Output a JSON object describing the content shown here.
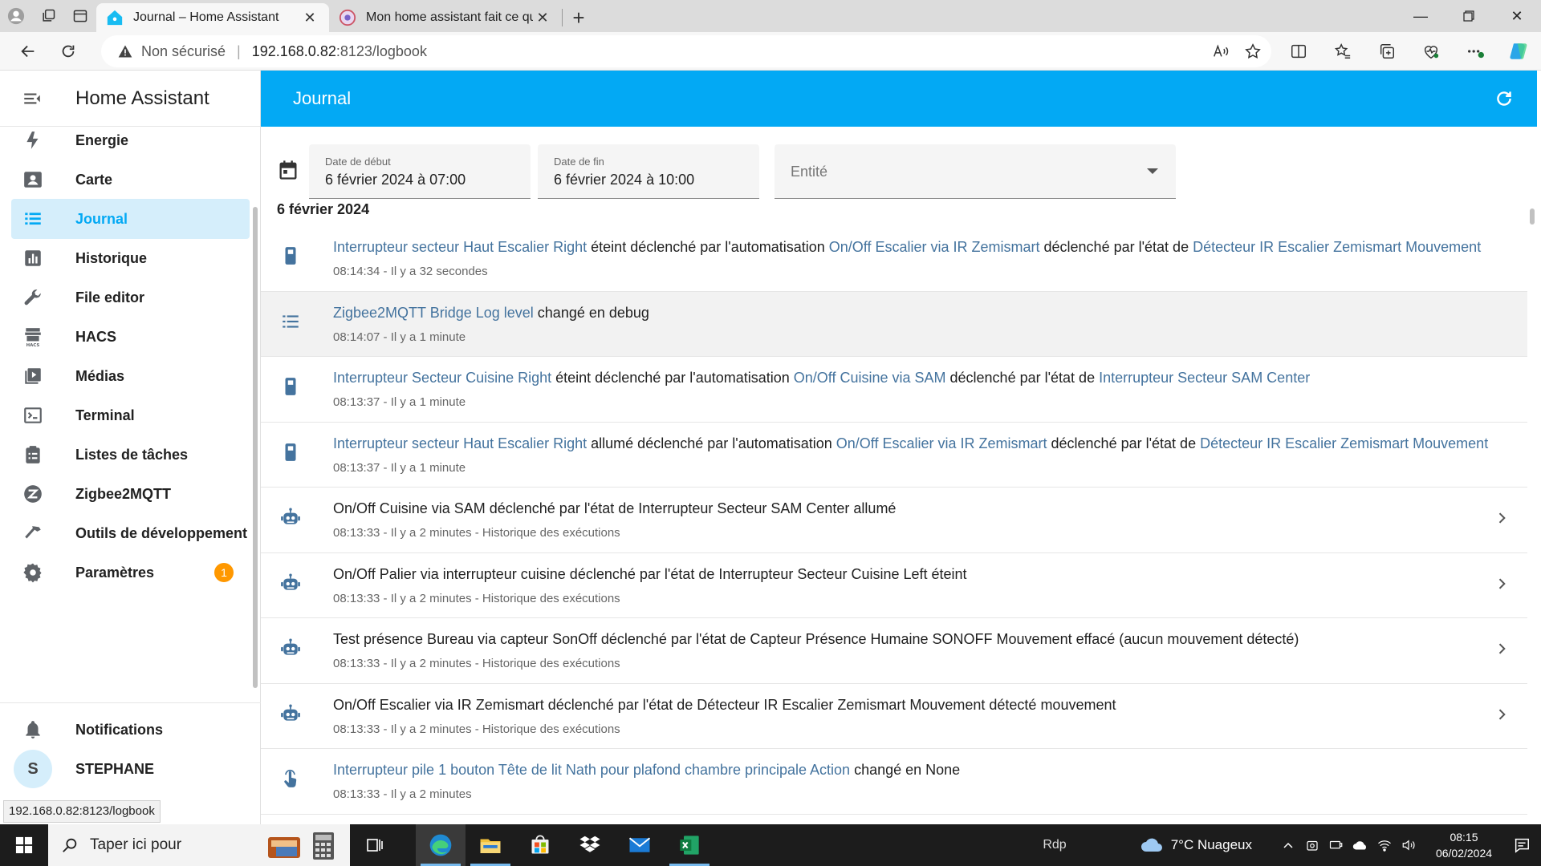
{
  "browser": {
    "tabs": [
      {
        "title": "Journal – Home Assistant",
        "active": true
      },
      {
        "title": "Mon home assistant fait ce qu'il veut",
        "active": false
      }
    ],
    "address": {
      "security": "Non sécurisé",
      "host": "192.168.0.82",
      "path": ":8123/logbook"
    },
    "status_url": "192.168.0.82:8123/logbook"
  },
  "sidebar": {
    "app_title": "Home Assistant",
    "items": [
      {
        "label": "Energie",
        "icon": "lightning-icon"
      },
      {
        "label": "Carte",
        "icon": "map-icon"
      },
      {
        "label": "Journal",
        "icon": "list-icon",
        "active": true
      },
      {
        "label": "Historique",
        "icon": "chart-icon"
      },
      {
        "label": "File editor",
        "icon": "wrench-icon"
      },
      {
        "label": "HACS",
        "icon": "hacs-icon"
      },
      {
        "label": "Médias",
        "icon": "media-icon"
      },
      {
        "label": "Terminal",
        "icon": "terminal-icon"
      },
      {
        "label": "Listes de tâches",
        "icon": "clipboard-icon"
      },
      {
        "label": "Zigbee2MQTT",
        "icon": "zigbee-icon"
      },
      {
        "label": "Outils de développement",
        "icon": "hammer-icon"
      },
      {
        "label": "Paramètres",
        "icon": "gear-icon",
        "badge": "1"
      }
    ],
    "notifications_label": "Notifications",
    "user": {
      "initial": "S",
      "name": "STEPHANE"
    }
  },
  "header": {
    "title": "Journal"
  },
  "filters": {
    "start": {
      "label": "Date de début",
      "value": "6 février 2024 à 07:00"
    },
    "end": {
      "label": "Date de fin",
      "value": "6 février 2024 à 10:00"
    },
    "entity": {
      "placeholder": "Entité"
    }
  },
  "log": {
    "date_heading": "6 février 2024",
    "entries": [
      {
        "icon": "switch-icon",
        "parts": [
          {
            "t": "Interrupteur secteur Haut Escalier Right",
            "link": true
          },
          {
            "t": " éteint déclenché par l'automatisation "
          },
          {
            "t": "On/Off Escalier via IR Zemismart",
            "link": true
          },
          {
            "t": " déclenché par l'état de "
          },
          {
            "t": "Détecteur IR Escalier Zemismart Mouvement",
            "link": true
          }
        ],
        "meta": "08:14:34 - Il y a 32 secondes"
      },
      {
        "icon": "list-icon",
        "highlight": true,
        "parts": [
          {
            "t": "Zigbee2MQTT Bridge Log level",
            "link": true
          },
          {
            "t": " changé en debug"
          }
        ],
        "meta": "08:14:07 - Il y a 1 minute"
      },
      {
        "icon": "switch-icon",
        "parts": [
          {
            "t": "Interrupteur Secteur Cuisine Right",
            "link": true
          },
          {
            "t": " éteint déclenché par l'automatisation "
          },
          {
            "t": "On/Off Cuisine via SAM",
            "link": true
          },
          {
            "t": " déclenché par l'état de "
          },
          {
            "t": "Interrupteur Secteur SAM Center",
            "link": true
          }
        ],
        "meta": "08:13:37 - Il y a 1 minute"
      },
      {
        "icon": "switch-icon",
        "parts": [
          {
            "t": "Interrupteur secteur Haut Escalier Right",
            "link": true
          },
          {
            "t": " allumé déclenché par l'automatisation "
          },
          {
            "t": "On/Off Escalier via IR Zemismart",
            "link": true
          },
          {
            "t": " déclenché par l'état de "
          },
          {
            "t": "Détecteur IR Escalier Zemismart Mouvement",
            "link": true
          }
        ],
        "meta": "08:13:37 - Il y a 1 minute"
      },
      {
        "icon": "robot-icon",
        "chevron": true,
        "parts": [
          {
            "t": "On/Off Cuisine via SAM déclenché par l'état de Interrupteur Secteur SAM Center allumé"
          }
        ],
        "meta": "08:13:33 - Il y a 2 minutes - Historique des exécutions"
      },
      {
        "icon": "robot-icon",
        "chevron": true,
        "parts": [
          {
            "t": "On/Off Palier via interrupteur cuisine déclenché par l'état de Interrupteur Secteur Cuisine Left éteint"
          }
        ],
        "meta": "08:13:33 - Il y a 2 minutes - Historique des exécutions"
      },
      {
        "icon": "robot-icon",
        "chevron": true,
        "parts": [
          {
            "t": "Test présence Bureau via capteur SonOff déclenché par l'état de Capteur Présence Humaine SONOFF Mouvement effacé (aucun mouvement détecté)"
          }
        ],
        "meta": "08:13:33 - Il y a 2 minutes - Historique des exécutions"
      },
      {
        "icon": "robot-icon",
        "chevron": true,
        "parts": [
          {
            "t": "On/Off Escalier via IR Zemismart déclenché par l'état de Détecteur IR Escalier Zemismart Mouvement détecté mouvement"
          }
        ],
        "meta": "08:13:33 - Il y a 2 minutes - Historique des exécutions"
      },
      {
        "icon": "gesture-tap-icon",
        "parts": [
          {
            "t": "Interrupteur pile 1 bouton Tête de lit Nath pour plafond chambre principale Action",
            "link": true
          },
          {
            "t": " changé en None"
          }
        ],
        "meta": "08:13:33 - Il y a 2 minutes"
      }
    ]
  },
  "taskbar": {
    "search_placeholder": "Taper ici pour",
    "rdp": "Rdp",
    "weather": "7°C  Nuageux",
    "time": "08:15",
    "date": "06/02/2024"
  },
  "colors": {
    "primary": "#03a9f4",
    "link": "#44739e",
    "active_bg": "#d5eefb",
    "badge": "#ff9800"
  }
}
